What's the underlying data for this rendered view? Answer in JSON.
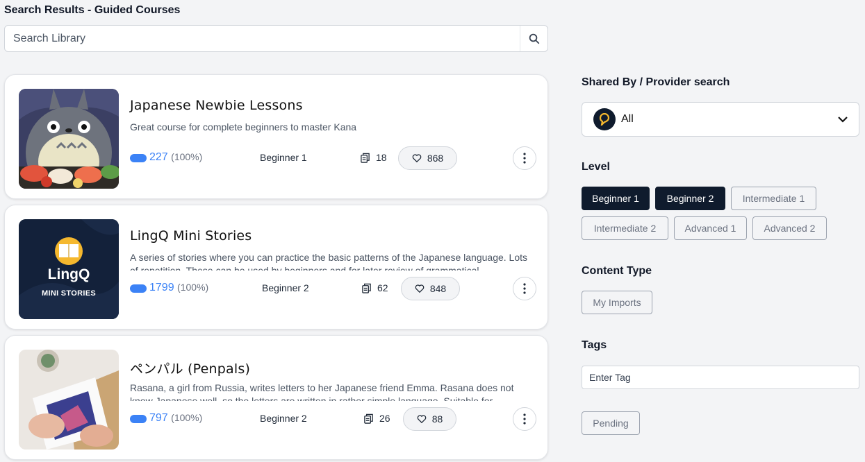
{
  "page": {
    "title": "Search Results - Guided Courses"
  },
  "search": {
    "placeholder": "Search Library"
  },
  "courses": [
    {
      "title": "Japanese Newbie Lessons",
      "description": "Great course for complete beginners to master Kana",
      "known_words": "227",
      "known_pct": "(100%)",
      "level": "Beginner 1",
      "lessons": "18",
      "likes": "868"
    },
    {
      "title": "LingQ Mini Stories",
      "description": "A series of stories where you can practice the basic patterns of the Japanese language. Lots of repetition. These can be used by beginners and for later review of grammatical",
      "known_words": "1799",
      "known_pct": "(100%)",
      "level": "Beginner 2",
      "lessons": "62",
      "likes": "848",
      "thumb_brand": "LingQ",
      "thumb_caption": "MINI STORIES"
    },
    {
      "title": "ペンパル (Penpals)",
      "description": "Rasana, a girl from Russia, writes letters to her Japanese friend Emma. Rasana does not know Japanese well, so the letters are written in rather simple language. Suitable for",
      "known_words": "797",
      "known_pct": "(100%)",
      "level": "Beginner 2",
      "lessons": "26",
      "likes": "88"
    }
  ],
  "sidebar": {
    "provider_heading": "Shared By / Provider search",
    "provider_value": "All",
    "level_heading": "Level",
    "levels": [
      {
        "label": "Beginner 1",
        "active": true
      },
      {
        "label": "Beginner 2",
        "active": true
      },
      {
        "label": "Intermediate 1",
        "active": false
      },
      {
        "label": "Intermediate 2",
        "active": false
      },
      {
        "label": "Advanced 1",
        "active": false
      },
      {
        "label": "Advanced 2",
        "active": false
      }
    ],
    "content_type_heading": "Content Type",
    "content_type": "My Imports",
    "tags_heading": "Tags",
    "tags_placeholder": "Enter Tag",
    "pending_label": "Pending"
  },
  "colors": {
    "accent": "#3b82f6",
    "navy": "#0f1b2d",
    "brand_yellow": "#f5b82e"
  },
  "icons": {
    "search": "search-icon",
    "lessons": "lessons-icon",
    "likes": "heart-icon",
    "more": "more-vertical-icon",
    "dropdown": "chevron-down-icon",
    "provider": "lingq-logo-icon"
  }
}
